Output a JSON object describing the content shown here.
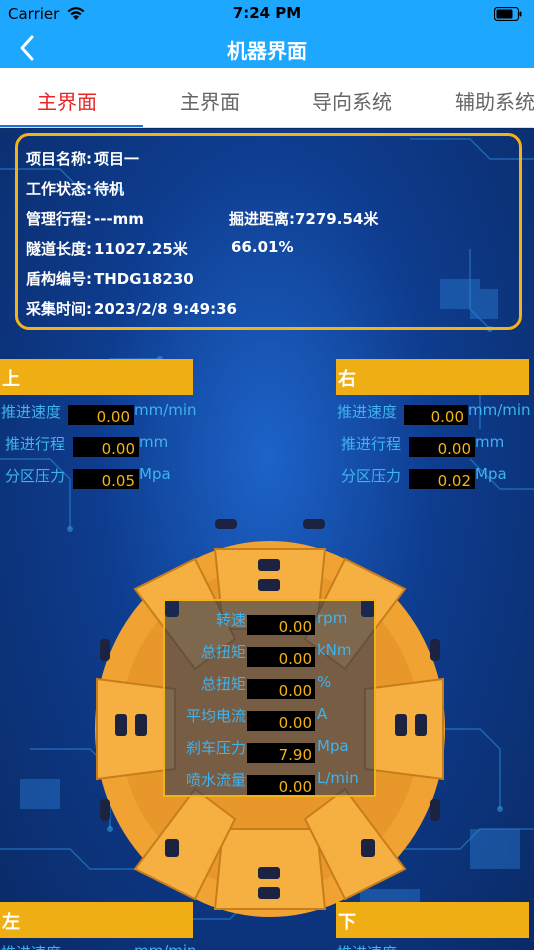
{
  "status": {
    "carrier": "Carrier",
    "time": "7:24 PM"
  },
  "nav": {
    "title": "机器界面"
  },
  "tabs": [
    {
      "label": "主界面",
      "active": true
    },
    {
      "label": "主界面",
      "active": false
    },
    {
      "label": "导向系统",
      "active": false
    },
    {
      "label": "辅助系统",
      "active": false
    }
  ],
  "info": {
    "project": {
      "label": "项目名称:",
      "value": "项目一"
    },
    "state": {
      "label": "工作状态:",
      "value": "待机"
    },
    "stroke": {
      "label": "管理行程:",
      "value": "---mm"
    },
    "distance": {
      "label": "掘进距离:",
      "value": "7279.54米"
    },
    "tunnel": {
      "label": "隧道长度:",
      "value": "11027.25米"
    },
    "percent": "66.01%",
    "shield": {
      "label": "盾构编号:",
      "value": "THDG18230"
    },
    "time": {
      "label": "采集时间:",
      "value": "2023/2/8  9:49:36"
    }
  },
  "sections": {
    "top": {
      "title": "上",
      "metrics": [
        {
          "label": "推进速度",
          "value": "0.00",
          "unit": "mm/min"
        },
        {
          "label": "推进行程",
          "value": "0.00",
          "unit": "mm"
        },
        {
          "label": "分区压力",
          "value": "0.05",
          "unit": "Mpa"
        }
      ]
    },
    "right": {
      "title": "右",
      "metrics": [
        {
          "label": "推进速度",
          "value": "0.00",
          "unit": "mm/min"
        },
        {
          "label": "推进行程",
          "value": "0.00",
          "unit": "mm"
        },
        {
          "label": "分区压力",
          "value": "0.02",
          "unit": "Mpa"
        }
      ]
    },
    "left": {
      "title": "左",
      "first_label": "推进速度",
      "first_unit": "mm/min"
    },
    "bottom": {
      "title": "下",
      "first_label": "推进速度"
    }
  },
  "cutterhead": [
    {
      "label": "转速",
      "value": "0.00",
      "unit": "rpm"
    },
    {
      "label": "总扭矩",
      "value": "0.00",
      "unit": "kNm"
    },
    {
      "label": "总扭矩",
      "value": "0.00",
      "unit": "%"
    },
    {
      "label": "平均电流",
      "value": "0.00",
      "unit": "A"
    },
    {
      "label": "刹车压力",
      "value": "7.90",
      "unit": "Mpa"
    },
    {
      "label": "喷水流量",
      "value": "0.00",
      "unit": "L/min"
    }
  ],
  "colors": {
    "accent": "#1ea7ff",
    "gold": "#f2b316",
    "label_blue": "#3fb3ef",
    "active_tab": "#e8262a"
  }
}
